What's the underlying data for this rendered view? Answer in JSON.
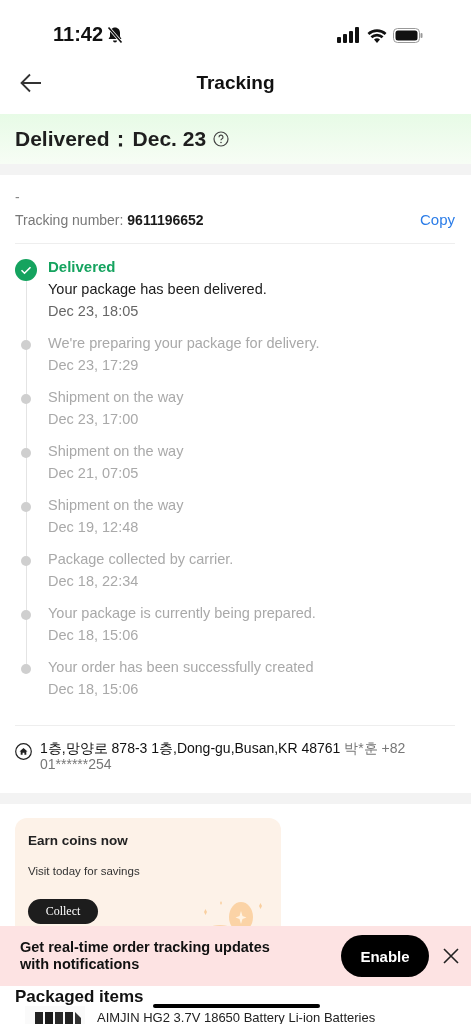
{
  "status_bar": {
    "time": "11:42"
  },
  "header": {
    "title": "Tracking"
  },
  "delivery_banner": {
    "label": "Delivered：",
    "date": "Dec. 23"
  },
  "tracking": {
    "dash": "-",
    "label": "Tracking number: ",
    "number": "9611196652",
    "copy": "Copy"
  },
  "timeline": [
    {
      "title": "Delivered",
      "message": "Your package has been delivered.",
      "time": "Dec 23, 18:05",
      "current": true
    },
    {
      "message": "We're preparing your package for delivery.",
      "time": "Dec 23, 17:29",
      "current": false
    },
    {
      "message": "Shipment on the way",
      "time": "Dec 23, 17:00",
      "current": false
    },
    {
      "message": "Shipment on the way",
      "time": "Dec 21, 07:05",
      "current": false
    },
    {
      "message": "Shipment on the way",
      "time": "Dec 19, 12:48",
      "current": false
    },
    {
      "message": "Package collected by carrier.",
      "time": "Dec 18, 22:34",
      "current": false
    },
    {
      "message": "Your package is currently being prepared.",
      "time": "Dec 18, 15:06",
      "current": false
    },
    {
      "message": "Your order has been successfully created",
      "time": "Dec 18, 15:06",
      "current": false
    }
  ],
  "address": {
    "text": "1층,망양로 878-3 1층,Dong-gu,Busan,KR 48761",
    "recipient": "박*훈 +82 01******254"
  },
  "promo_card": {
    "title": "Earn coins now",
    "subtitle": "Visit today for savings",
    "button": "Collect"
  },
  "notification_banner": {
    "text": "Get real-time order tracking updates with notifications",
    "button": "Enable"
  },
  "packaged_items": {
    "title": "Packaged items",
    "items": [
      {
        "title": "AIMJIN HG2 3.7V 18650 Battery Li-ion Batteries"
      }
    ]
  }
}
